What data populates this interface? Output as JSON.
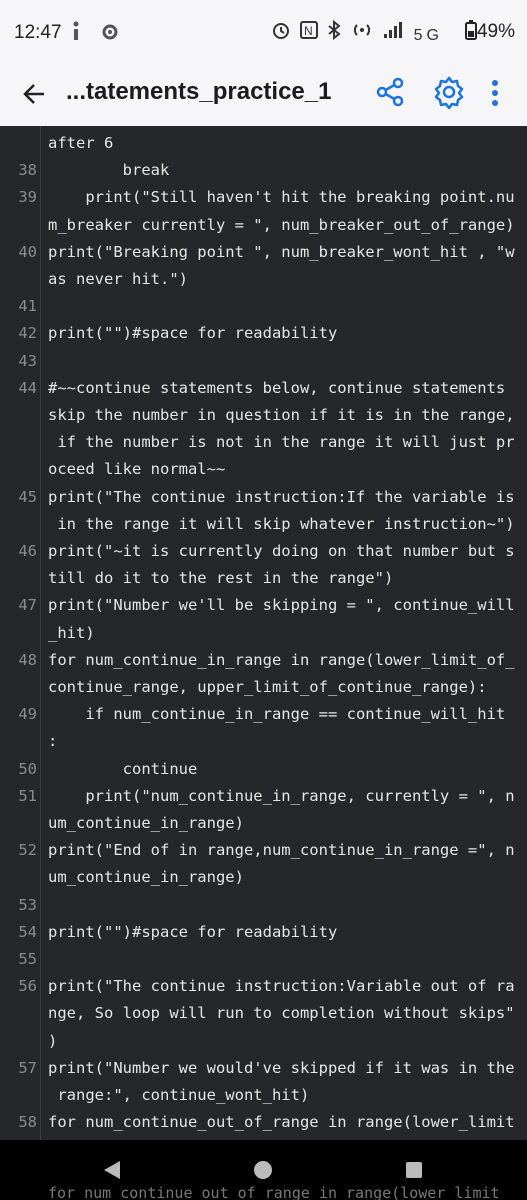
{
  "status_bar": {
    "time": "12:47",
    "left_icons": "i⚙",
    "right_icons": "⏰ N ✱ ◎ ▐ 5G",
    "battery": "49%"
  },
  "app_bar": {
    "title": "...tatements_practice_1",
    "back_icon": "arrow-left",
    "share_icon": "share",
    "settings_icon": "gear",
    "more_icon": "dots-vertical",
    "accent_color": "#1a73e8"
  },
  "code": {
    "partial_top": "  *~~~~ ~~~ ~ ~~~~ ~~~~~~ ~~~~~~ ~~~~~~~~",
    "lines": [
      {
        "n": "",
        "t": "after 6"
      },
      {
        "n": "38",
        "t": "        break"
      },
      {
        "n": "39",
        "t": "    print(\"Still haven't hit the breaking point.nu"
      },
      {
        "n": "",
        "t": "m_breaker currently = \", num_breaker_out_of_range)"
      },
      {
        "n": "40",
        "t": "print(\"Breaking point \", num_breaker_wont_hit , \"w"
      },
      {
        "n": "",
        "t": "as never hit.\")"
      },
      {
        "n": "41",
        "t": ""
      },
      {
        "n": "42",
        "t": "print(\"\")#space for readability"
      },
      {
        "n": "43",
        "t": ""
      },
      {
        "n": "44",
        "t": "#~~continue statements below, continue statements"
      },
      {
        "n": "",
        "t": "skip the number in question if it is in the range,"
      },
      {
        "n": "",
        "t": " if the number is not in the range it will just pr"
      },
      {
        "n": "",
        "t": "oceed like normal~~"
      },
      {
        "n": "45",
        "t": "print(\"The continue instruction:If the variable is"
      },
      {
        "n": "",
        "t": " in the range it will skip whatever instruction~\")"
      },
      {
        "n": "46",
        "t": "print(\"~it is currently doing on that number but s"
      },
      {
        "n": "",
        "t": "till do it to the rest in the range\")"
      },
      {
        "n": "47",
        "t": "print(\"Number we'll be skipping = \", continue_will"
      },
      {
        "n": "",
        "t": "_hit)"
      },
      {
        "n": "48",
        "t": "for num_continue_in_range in range(lower_limit_of_"
      },
      {
        "n": "",
        "t": "continue_range, upper_limit_of_continue_range):"
      },
      {
        "n": "49",
        "t": "    if num_continue_in_range == continue_will_hit"
      },
      {
        "n": "",
        "t": ":"
      },
      {
        "n": "50",
        "t": "        continue"
      },
      {
        "n": "51",
        "t": "    print(\"num_continue_in_range, currently = \", n"
      },
      {
        "n": "",
        "t": "um_continue_in_range)"
      },
      {
        "n": "52",
        "t": "print(\"End of in range,num_continue_in_range =\", n"
      },
      {
        "n": "",
        "t": "um_continue_in_range)"
      },
      {
        "n": "53",
        "t": ""
      },
      {
        "n": "54",
        "t": "print(\"\")#space for readability"
      },
      {
        "n": "55",
        "t": ""
      },
      {
        "n": "56",
        "t": "print(\"The continue instruction:Variable out of ra"
      },
      {
        "n": "",
        "t": "nge, So loop will run to completion without skips\""
      },
      {
        "n": "",
        "t": ")"
      },
      {
        "n": "57",
        "t": "print(\"Number we would've skipped if it was in the"
      },
      {
        "n": "",
        "t": " range:\", continue_wont_hit)"
      },
      {
        "n": "58",
        "t": "for num_continue_out_of_range in range(lower_limit"
      }
    ]
  },
  "nav_bar": {
    "back_icon": "triangle-left",
    "home_icon": "circle",
    "recents_icon": "square",
    "peek_text": "for num_continue_out_of_range in range(lower_limit"
  }
}
